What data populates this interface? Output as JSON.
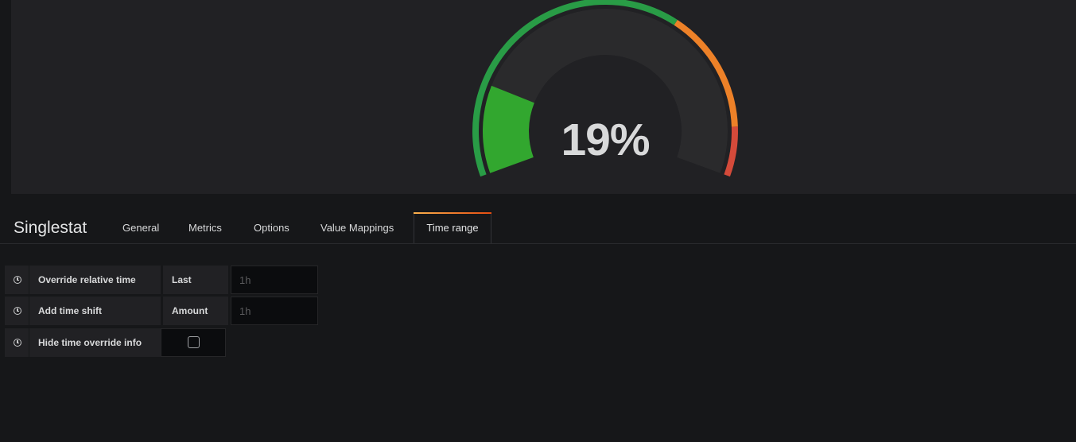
{
  "gauge": {
    "value_text": "19%",
    "value": 19,
    "min": 0,
    "max": 100,
    "thresholds": [
      {
        "color": "#299c46",
        "from": 0,
        "to": 65
      },
      {
        "color": "#ed8128",
        "from": 65,
        "to": 90
      },
      {
        "color": "#d44a3a",
        "from": 90,
        "to": 100
      }
    ],
    "value_color": "#32a72f"
  },
  "editor": {
    "title": "Singlestat",
    "tabs": [
      {
        "label": "General"
      },
      {
        "label": "Metrics"
      },
      {
        "label": "Options"
      },
      {
        "label": "Value Mappings"
      },
      {
        "label": "Time range"
      }
    ],
    "active_tab": "Time range"
  },
  "time_range": {
    "override_relative": {
      "label": "Override relative time",
      "field_label": "Last",
      "placeholder": "1h",
      "value": ""
    },
    "time_shift": {
      "label": "Add time shift",
      "field_label": "Amount",
      "placeholder": "1h",
      "value": ""
    },
    "hide_info": {
      "label": "Hide time override info",
      "checked": false
    }
  },
  "icons": {
    "row_icon": "clock-icon"
  }
}
